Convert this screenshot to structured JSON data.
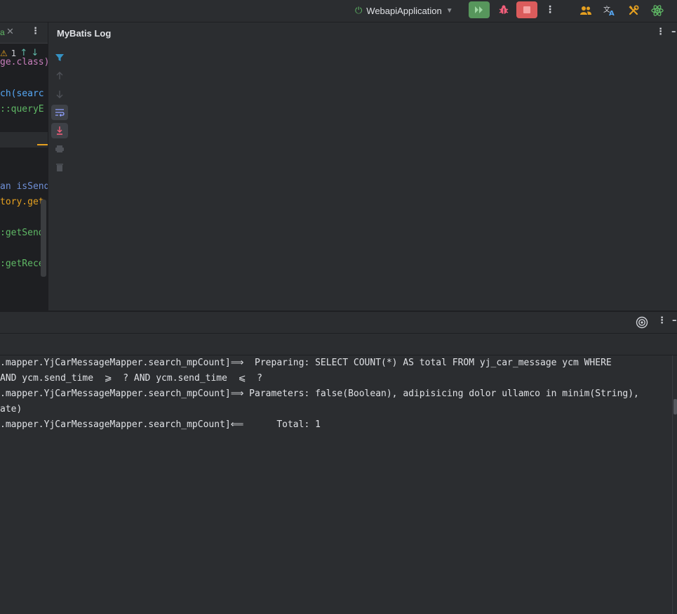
{
  "titlebar": {
    "run_config": "WebapiApplication",
    "icons": [
      "power-icon",
      "run-icon",
      "debug-bug-icon",
      "stop-icon",
      "more-vertical-icon",
      "people-icon",
      "translate-icon",
      "build-tools-icon",
      "atom-icon"
    ]
  },
  "editor": {
    "tab_label": "a",
    "inspection_count": "1",
    "code_lines": [
      {
        "text": "ge.class)",
        "color": "#c77dbb"
      },
      {
        "text": "ch(searc",
        "color": "#56a8f5"
      },
      {
        "text": "::queryE",
        "color": "#5fb865"
      },
      {
        "text": "an isSend",
        "color": "#6f8fd6"
      },
      {
        "text": "tory.get",
        "color": "#e5a020"
      },
      {
        "text": ":getSend",
        "color": "#5fb865"
      },
      {
        "text": ":getRece",
        "color": "#5fb865"
      }
    ]
  },
  "mybatis": {
    "title": "MyBatis Log"
  },
  "console": {
    "lines": [
      ".mapper.YjCarMessageMapper.search_mpCount]⟹  Preparing: SELECT COUNT(*) AS total FROM yj_car_message ycm WHERE",
      "AND ycm.send_time  ⩾  ? AND ycm.send_time  ⩽  ?",
      ".mapper.YjCarMessageMapper.search_mpCount]⟹ Parameters: false(Boolean), adipisicing dolor ullamco in minim(String),",
      "ate)",
      ".mapper.YjCarMessageMapper.search_mpCount]⟸      Total: 1"
    ]
  },
  "colors": {
    "run_green": "#57965c",
    "stop_red": "#db5c5c",
    "panel_bg": "#2b2d30",
    "editor_bg": "#1e1f22",
    "accent_blue": "#3574f0"
  }
}
